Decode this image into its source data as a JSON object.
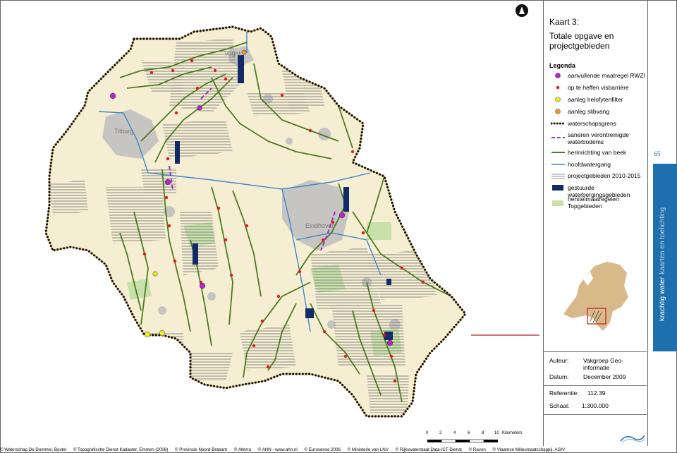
{
  "map": {
    "cities": [
      "Vught",
      "Tilburg",
      "Eindhoven"
    ],
    "colors": {
      "land": "#f5eed3",
      "urban": "#bdbdbd",
      "topgebied": "#c8e0a9",
      "beek": "#4b7a1f",
      "hoofdwatergang": "#3f86c9",
      "gestuurde": "#142a66",
      "waterschapsgrens_dot": "#e8a21d",
      "rwzi": "#c020d0",
      "visbarriere": "#e01b1b",
      "helofyt": "#e9f01c",
      "slibvang": "#e89a2c",
      "sanering": "#9b2fbf",
      "project_hatch": "#6f6f6f"
    }
  },
  "panel": {
    "title": "Kaart 3:",
    "subtitle": "Totale opgave en projectgebieden",
    "legend_title": "Legenda",
    "legend": [
      {
        "symbol": "rwzi-dot",
        "label": "aanvullende maatregel RWZI"
      },
      {
        "symbol": "visbarriere-dot",
        "label": "op te heffen visbarrière"
      },
      {
        "symbol": "helofyt-dot",
        "label": "aanleg helofytenfilter"
      },
      {
        "symbol": "slibvang-dot",
        "label": "aanleg slibvang"
      },
      {
        "symbol": "border-line",
        "label": "waterschapsgrens"
      },
      {
        "symbol": "sanering-line",
        "label": "saneren verontreinigde waterbodems"
      },
      {
        "symbol": "beek-line",
        "label": "herinrichting van beek"
      },
      {
        "symbol": "hoofd-line",
        "label": "hoofdwatergang"
      },
      {
        "symbol": "project-hatch",
        "label": "projectgebieden 2010-2015"
      },
      {
        "symbol": "gestuurde-rect",
        "label": "gestuurde waterbergingsgebieden"
      },
      {
        "symbol": "topgebied-rect",
        "label": "herstelmaatregelen Topgebieden"
      }
    ],
    "author_label": "Auteur:",
    "author": "Vakgroep Geo-informatie",
    "date_label": "Datum:",
    "date": "December 2009",
    "ref_label": "Referentie:",
    "ref": "112.39",
    "scale_label": "Schaal:",
    "scale": "1:300.000"
  },
  "side": {
    "page_number": "65",
    "tagline_bold": "krachtig water",
    "tagline_light": "kaarten en toelichting"
  },
  "scalebar": {
    "ticks": [
      "0",
      "2",
      "4",
      "6",
      "8",
      "10"
    ],
    "unit": "Kilometers"
  },
  "credits": [
    "© Waterschap De Dommel, Boxtel",
    "© Topografische Dienst Kadaster, Emmen (2008)",
    "© Provincie Noord-Brabant",
    "© Alterra",
    "© AHN - www.ahn.nl",
    "© Eurosense 2006",
    "© Ministerie van LNV",
    "© Rijkswaterstaat Data-ICT-Dienst",
    "© Ravon",
    "© Vlaamse Milieumaatschappij, AGIV"
  ]
}
